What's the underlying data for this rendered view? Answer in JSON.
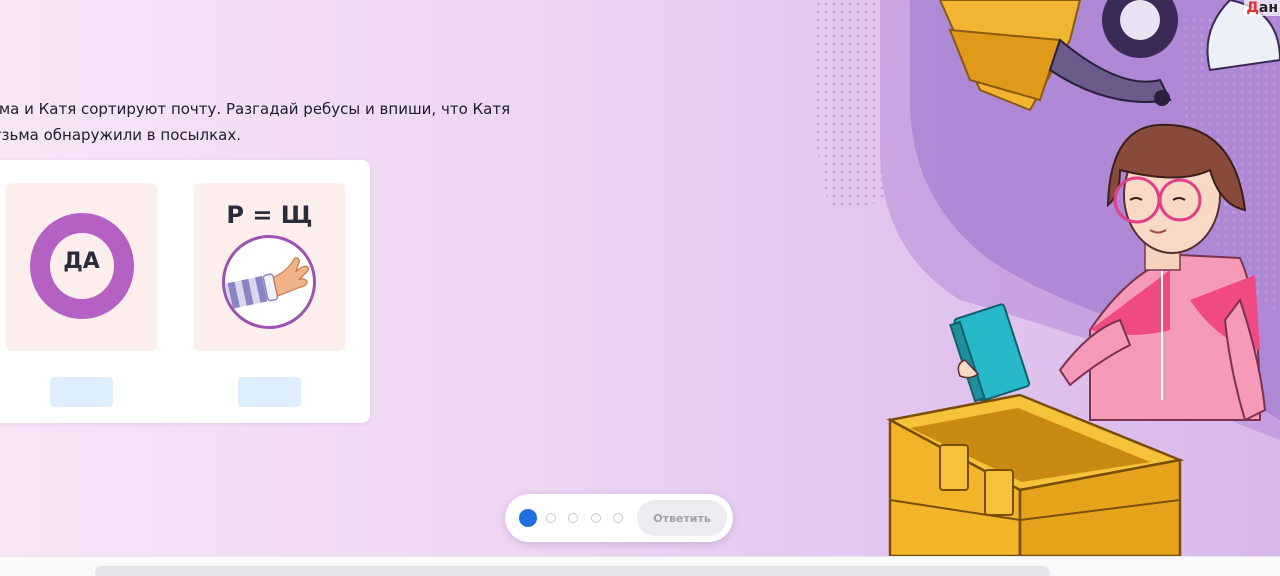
{
  "task": {
    "line1": "зьма и Катя сортируют почту. Разгадай ребусы и впиши, что Катя",
    "line2": "Кузьма обнаружили в посылках."
  },
  "rebus1": {
    "inner_text": "ДА",
    "ring_letter": "O"
  },
  "rebus2": {
    "equation": "Р = Щ"
  },
  "top_right": {
    "red_part": "Д",
    "rest": "ан"
  },
  "pager": {
    "total_steps": 5,
    "current_step": 1,
    "answer_label": "Ответить"
  },
  "colors": {
    "accent_purple": "#b561c4",
    "active_dot": "#1f6fe0",
    "answer_box": "#dfeefc"
  }
}
